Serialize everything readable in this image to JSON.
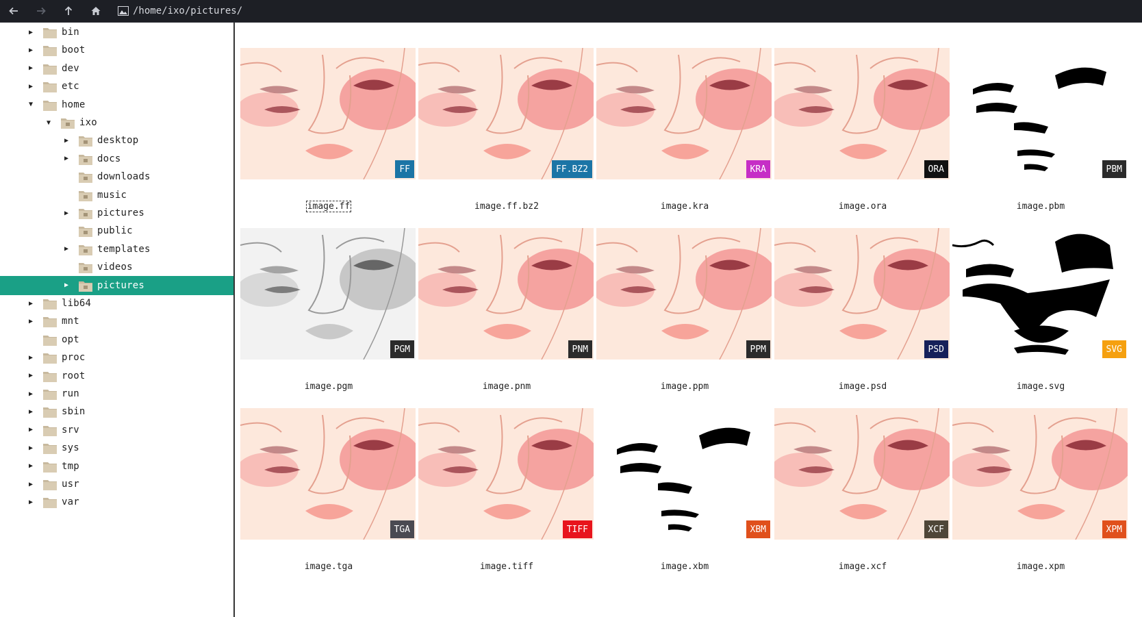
{
  "toolbar": {
    "path": "/home/ixo/pictures/",
    "buttons": [
      {
        "name": "back-button",
        "icon": "arrow-left-icon",
        "disabled": false
      },
      {
        "name": "forward-button",
        "icon": "arrow-right-icon",
        "disabled": true
      },
      {
        "name": "up-button",
        "icon": "arrow-up-icon",
        "disabled": false
      },
      {
        "name": "home-button",
        "icon": "home-icon",
        "disabled": false
      }
    ]
  },
  "tree": [
    {
      "label": "bin",
      "depth": 0,
      "expander": "collapsed",
      "icon": "folder-icon"
    },
    {
      "label": "boot",
      "depth": 0,
      "expander": "collapsed",
      "icon": "folder-icon"
    },
    {
      "label": "dev",
      "depth": 0,
      "expander": "collapsed",
      "icon": "folder-icon"
    },
    {
      "label": "etc",
      "depth": 0,
      "expander": "collapsed",
      "icon": "folder-icon"
    },
    {
      "label": "home",
      "depth": 0,
      "expander": "expanded",
      "icon": "folder-icon"
    },
    {
      "label": "ixo",
      "depth": 1,
      "expander": "expanded",
      "icon": "folder-home-icon"
    },
    {
      "label": "desktop",
      "depth": 2,
      "expander": "collapsed",
      "icon": "folder-desktop-icon"
    },
    {
      "label": "docs",
      "depth": 2,
      "expander": "collapsed",
      "icon": "folder-documents-icon"
    },
    {
      "label": "downloads",
      "depth": 2,
      "expander": "none",
      "icon": "folder-downloads-icon"
    },
    {
      "label": "music",
      "depth": 2,
      "expander": "none",
      "icon": "folder-music-icon"
    },
    {
      "label": "pictures",
      "depth": 2,
      "expander": "collapsed",
      "icon": "folder-pictures-icon"
    },
    {
      "label": "public",
      "depth": 2,
      "expander": "none",
      "icon": "folder-public-icon"
    },
    {
      "label": "templates",
      "depth": 2,
      "expander": "collapsed",
      "icon": "folder-templates-icon"
    },
    {
      "label": "videos",
      "depth": 2,
      "expander": "none",
      "icon": "folder-videos-icon"
    },
    {
      "label": "pictures",
      "depth": 2,
      "expander": "collapsed",
      "icon": "folder-pictures-icon",
      "selected": true
    },
    {
      "label": "lib64",
      "depth": 0,
      "expander": "collapsed",
      "icon": "folder-icon"
    },
    {
      "label": "mnt",
      "depth": 0,
      "expander": "collapsed",
      "icon": "folder-icon"
    },
    {
      "label": "opt",
      "depth": 0,
      "expander": "none",
      "icon": "folder-icon"
    },
    {
      "label": "proc",
      "depth": 0,
      "expander": "collapsed",
      "icon": "folder-icon"
    },
    {
      "label": "root",
      "depth": 0,
      "expander": "collapsed",
      "icon": "folder-icon"
    },
    {
      "label": "run",
      "depth": 0,
      "expander": "collapsed",
      "icon": "folder-icon"
    },
    {
      "label": "sbin",
      "depth": 0,
      "expander": "collapsed",
      "icon": "folder-icon"
    },
    {
      "label": "srv",
      "depth": 0,
      "expander": "collapsed",
      "icon": "folder-icon"
    },
    {
      "label": "sys",
      "depth": 0,
      "expander": "collapsed",
      "icon": "folder-icon"
    },
    {
      "label": "tmp",
      "depth": 0,
      "expander": "collapsed",
      "icon": "folder-icon"
    },
    {
      "label": "usr",
      "depth": 0,
      "expander": "collapsed",
      "icon": "folder-icon"
    },
    {
      "label": "var",
      "depth": 0,
      "expander": "collapsed",
      "icon": "folder-icon"
    }
  ],
  "files": [
    {
      "name": "image.ff",
      "badge": "FF",
      "badge_color": "#1b75a6",
      "style": "color",
      "focused": true
    },
    {
      "name": "image.ff.bz2",
      "badge": "FF.BZ2",
      "badge_color": "#1b75a6",
      "style": "color"
    },
    {
      "name": "image.kra",
      "badge": "KRA",
      "badge_color": "#c62ec6",
      "style": "color"
    },
    {
      "name": "image.ora",
      "badge": "ORA",
      "badge_color": "#111111",
      "style": "color"
    },
    {
      "name": "image.pbm",
      "badge": "PBM",
      "badge_color": "#2b2b2b",
      "style": "bw"
    },
    {
      "name": "image.pgm",
      "badge": "PGM",
      "badge_color": "#2b2b2b",
      "style": "gray"
    },
    {
      "name": "image.pnm",
      "badge": "PNM",
      "badge_color": "#2b2b2b",
      "style": "color"
    },
    {
      "name": "image.ppm",
      "badge": "PPM",
      "badge_color": "#2b2b2b",
      "style": "color"
    },
    {
      "name": "image.psd",
      "badge": "PSD",
      "badge_color": "#16205a",
      "style": "color"
    },
    {
      "name": "image.svg",
      "badge": "SVG",
      "badge_color": "#f5a00f",
      "style": "bwsolid"
    },
    {
      "name": "image.tga",
      "badge": "TGA",
      "badge_color": "#4a4a52",
      "style": "color"
    },
    {
      "name": "image.tiff",
      "badge": "TIFF",
      "badge_color": "#e8141c",
      "style": "color"
    },
    {
      "name": "image.xbm",
      "badge": "XBM",
      "badge_color": "#e0501c",
      "style": "bw"
    },
    {
      "name": "image.xcf",
      "badge": "XCF",
      "badge_color": "#4f4638",
      "style": "color"
    },
    {
      "name": "image.xpm",
      "badge": "XPM",
      "badge_color": "#e0501c",
      "style": "color"
    }
  ],
  "colors": {
    "toolbar_bg": "#1d1f25",
    "selection": "#1aa086",
    "folder": "#c8b99e"
  }
}
